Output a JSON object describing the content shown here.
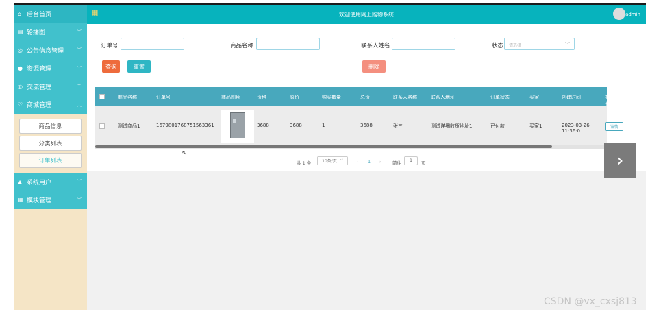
{
  "header": {
    "title": "欢迎使用网上购物系统",
    "user": "admin"
  },
  "sidebar": {
    "items": [
      {
        "label": "后台首页",
        "icon": "home-icon"
      },
      {
        "label": "轮播图",
        "icon": "image-icon"
      },
      {
        "label": "公告信息管理",
        "icon": "notice-icon"
      },
      {
        "label": "资源管理",
        "icon": "resource-icon"
      },
      {
        "label": "交流管理",
        "icon": "chat-icon"
      },
      {
        "label": "商城管理",
        "icon": "shop-icon"
      }
    ],
    "sub_items": [
      {
        "label": "商品信息"
      },
      {
        "label": "分类列表"
      },
      {
        "label": "订单列表"
      }
    ],
    "bottom_items": [
      {
        "label": "系统用户",
        "icon": "user-icon"
      },
      {
        "label": "模块管理",
        "icon": "module-icon"
      }
    ]
  },
  "search": {
    "order_no_label": "订单号",
    "product_name_label": "商品名称",
    "contact_name_label": "联系人姓名",
    "status_label": "状态",
    "status_placeholder": "请选择",
    "query_button": "查询",
    "reset_button": "重置",
    "delete_button": "删除"
  },
  "table": {
    "columns": [
      "商品名称",
      "订单号",
      "商品图片",
      "价格",
      "原价",
      "购买数量",
      "总价",
      "联系人名称",
      "联系人地址",
      "订单状态",
      "买家",
      "创建时间",
      "操作"
    ],
    "rows": [
      {
        "product": "测试商品1",
        "order_no": "1679801768751563361",
        "price": "3688",
        "original": "3688",
        "qty": "1",
        "total": "3688",
        "contact": "张三",
        "address": "测试详细收货地址1",
        "status": "已付款",
        "buyer": "买家1",
        "created": "2023-03-26 11:36:0",
        "action": "详情"
      }
    ]
  },
  "pagination": {
    "total": "共 1 条",
    "page_size": "10条/页",
    "prev": "‹",
    "current": "1",
    "next": "›",
    "goto_label": "前往",
    "goto_value": "1",
    "page_unit": "页"
  },
  "overlay": {
    "next_arrow": "›",
    "watermark": "CSDN @vx_cxsj813"
  },
  "colors": {
    "header": "#07b3bd",
    "menu": "#41c1cc",
    "table_header": "#48a8bd",
    "query": "#ee6b3c",
    "reset": "#2fb6c4",
    "delete": "#f48f7f",
    "sidebar_bg": "#f5e5c6"
  }
}
